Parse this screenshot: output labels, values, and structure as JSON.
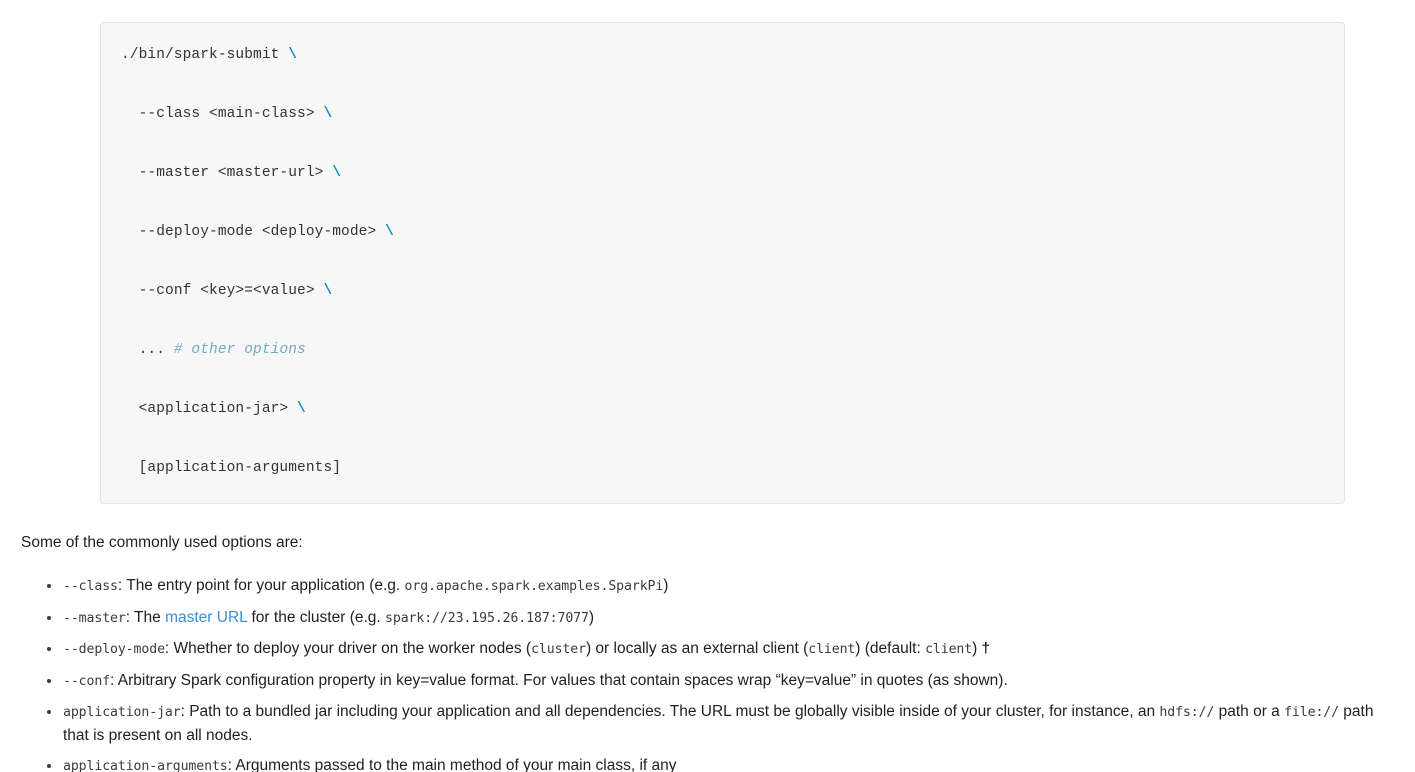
{
  "code_block": {
    "name": "spark-submit-usage",
    "lines": [
      {
        "indent": 0,
        "parts": [
          {
            "t": "text",
            "v": "./bin/spark-submit "
          },
          {
            "t": "cont",
            "v": "\\"
          }
        ]
      },
      {
        "indent": 1,
        "parts": [
          {
            "t": "text",
            "v": "--class <main-class> "
          },
          {
            "t": "cont",
            "v": "\\"
          }
        ]
      },
      {
        "indent": 1,
        "parts": [
          {
            "t": "text",
            "v": "--master <master-url> "
          },
          {
            "t": "cont",
            "v": "\\"
          }
        ]
      },
      {
        "indent": 1,
        "parts": [
          {
            "t": "text",
            "v": "--deploy-mode <deploy-mode> "
          },
          {
            "t": "cont",
            "v": "\\"
          }
        ]
      },
      {
        "indent": 1,
        "parts": [
          {
            "t": "text",
            "v": "--conf <key>=<value> "
          },
          {
            "t": "cont",
            "v": "\\"
          }
        ]
      },
      {
        "indent": 1,
        "parts": [
          {
            "t": "text",
            "v": "... "
          },
          {
            "t": "comment",
            "v": "# other options"
          }
        ]
      },
      {
        "indent": 1,
        "parts": [
          {
            "t": "text",
            "v": "<application-jar> "
          },
          {
            "t": "cont",
            "v": "\\"
          }
        ]
      },
      {
        "indent": 1,
        "parts": [
          {
            "t": "text",
            "v": "[application-arguments]"
          }
        ]
      }
    ]
  },
  "lead_paragraph": "Some of the commonly used options are:",
  "options": [
    {
      "id": "class",
      "parts": [
        {
          "t": "mono",
          "v": "--class"
        },
        {
          "t": "text",
          "v": ": The entry point for your application (e.g. "
        },
        {
          "t": "mono",
          "v": "org.apache.spark.examples.SparkPi"
        },
        {
          "t": "text",
          "v": ")"
        }
      ]
    },
    {
      "id": "master",
      "parts": [
        {
          "t": "mono",
          "v": "--master"
        },
        {
          "t": "text",
          "v": ": The "
        },
        {
          "t": "link",
          "v": "master URL"
        },
        {
          "t": "text",
          "v": " for the cluster (e.g. "
        },
        {
          "t": "mono",
          "v": "spark://23.195.26.187:7077"
        },
        {
          "t": "text",
          "v": ")"
        }
      ]
    },
    {
      "id": "deploy-mode",
      "parts": [
        {
          "t": "mono",
          "v": "--deploy-mode"
        },
        {
          "t": "text",
          "v": ": Whether to deploy your driver on the worker nodes ("
        },
        {
          "t": "mono",
          "v": "cluster"
        },
        {
          "t": "text",
          "v": ") or locally as an external client ("
        },
        {
          "t": "mono",
          "v": "client"
        },
        {
          "t": "text",
          "v": ") (default: "
        },
        {
          "t": "mono",
          "v": "client"
        },
        {
          "t": "text",
          "v": ") "
        },
        {
          "t": "dagger",
          "v": "†"
        }
      ]
    },
    {
      "id": "conf",
      "parts": [
        {
          "t": "mono",
          "v": "--conf"
        },
        {
          "t": "text",
          "v": ": Arbitrary Spark configuration property in key=value format. For values that contain spaces wrap “key=value” in quotes (as shown)."
        }
      ]
    },
    {
      "id": "application-jar",
      "parts": [
        {
          "t": "mono",
          "v": "application-jar"
        },
        {
          "t": "text",
          "v": ": Path to a bundled jar including your application and all dependencies. The URL must be globally visible inside of your cluster, for instance, an "
        },
        {
          "t": "mono",
          "v": "hdfs://"
        },
        {
          "t": "text",
          "v": " path or a "
        },
        {
          "t": "mono",
          "v": "file://"
        },
        {
          "t": "text",
          "v": " path that is present on all nodes."
        }
      ]
    },
    {
      "id": "application-arguments",
      "parts": [
        {
          "t": "mono",
          "v": "application-arguments"
        },
        {
          "t": "text",
          "v": ": Arguments passed to the main method of your main class, if any"
        }
      ]
    }
  ],
  "colors": {
    "code_background": "#f7f7f7",
    "code_border": "#e3e3e3",
    "continuation": "#0b8ec4",
    "comment": "#74a9bd",
    "link": "#3a8fd6",
    "text": "#1f1f1f",
    "mono_text": "#3b3b3b"
  }
}
